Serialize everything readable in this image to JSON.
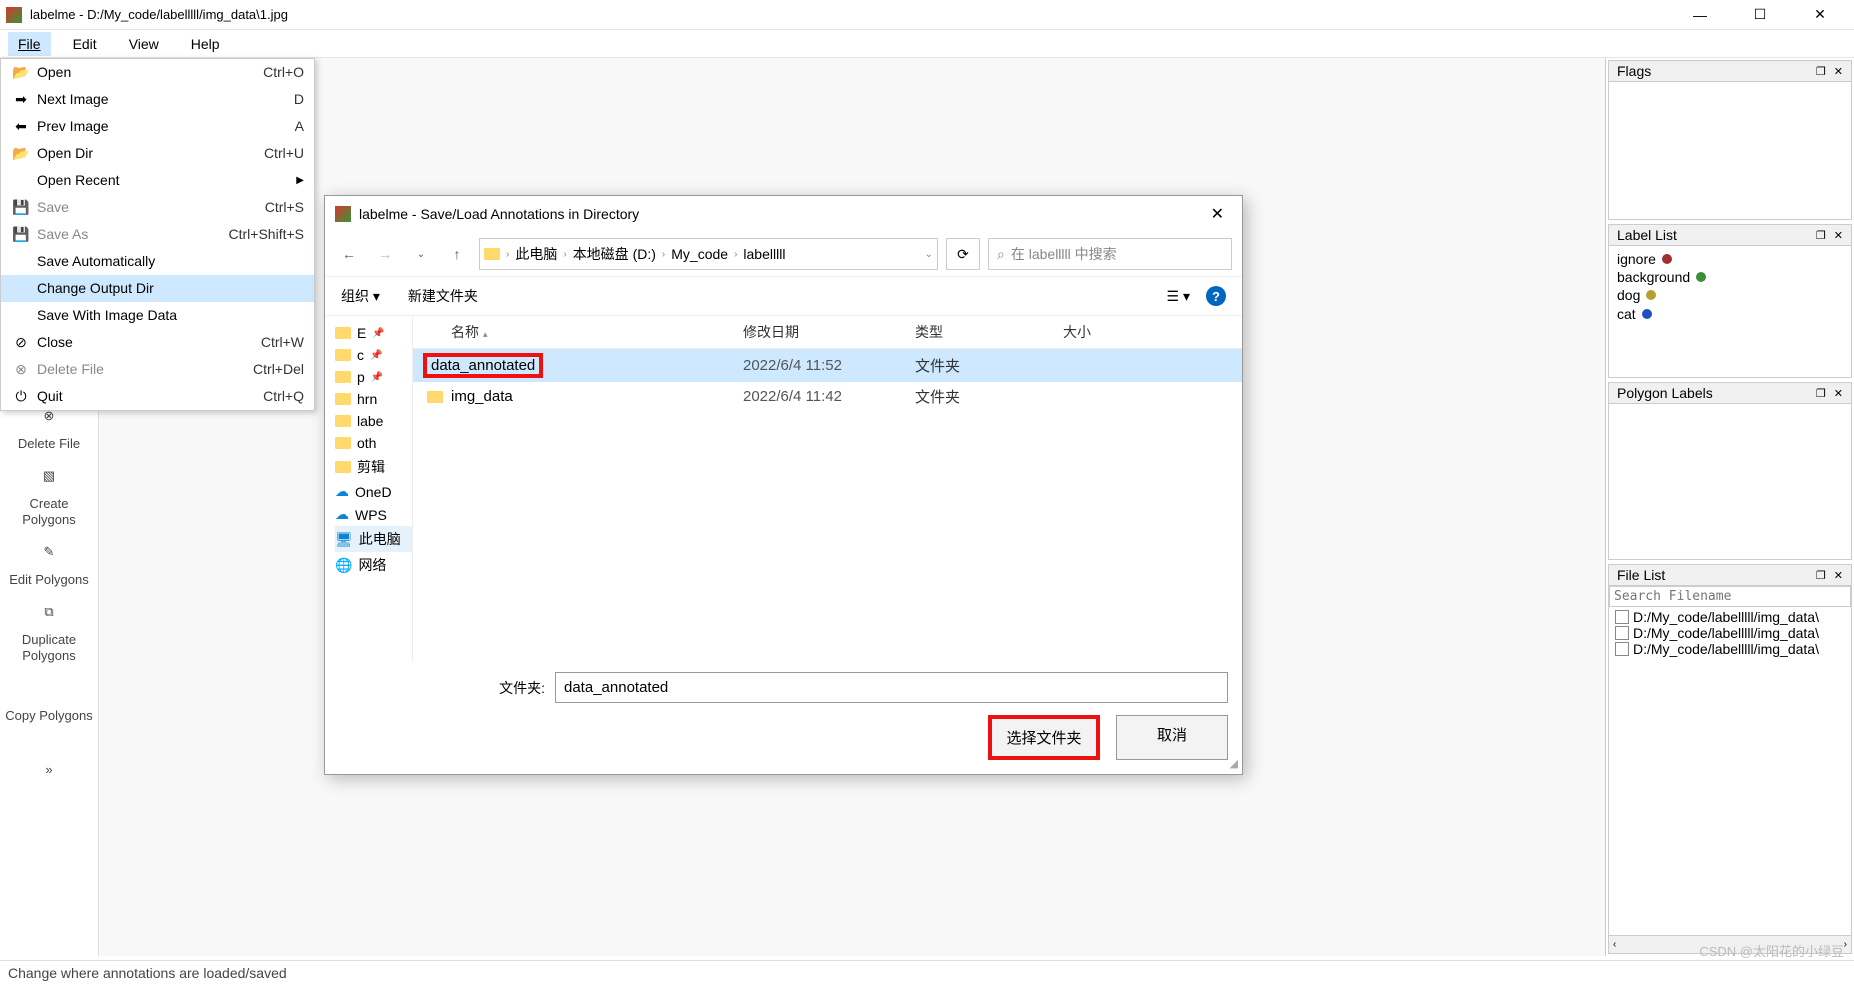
{
  "window": {
    "title": "labelme - D:/My_code/labelllll/img_data\\1.jpg"
  },
  "menubar": {
    "items": [
      "File",
      "Edit",
      "View",
      "Help"
    ],
    "active_index": 0
  },
  "file_menu": {
    "items": [
      {
        "label": "Open",
        "short": "Ctrl+O",
        "icon": "open"
      },
      {
        "label": "Next Image",
        "short": "D",
        "icon": "next"
      },
      {
        "label": "Prev Image",
        "short": "A",
        "icon": "prev"
      },
      {
        "label": "Open Dir",
        "short": "Ctrl+U",
        "icon": "open"
      },
      {
        "label": "Open Recent",
        "short": "",
        "icon": "",
        "arrow": true
      },
      {
        "label": "Save",
        "short": "Ctrl+S",
        "icon": "save",
        "disabled": true
      },
      {
        "label": "Save As",
        "short": "Ctrl+Shift+S",
        "icon": "saveas",
        "disabled": true
      },
      {
        "label": "Save Automatically",
        "short": "",
        "icon": ""
      },
      {
        "label": "Change Output Dir",
        "short": "",
        "icon": "",
        "highlight": true
      },
      {
        "label": "Save With Image Data",
        "short": "",
        "icon": ""
      },
      {
        "label": "Close",
        "short": "Ctrl+W",
        "icon": "close"
      },
      {
        "label": "Delete File",
        "short": "Ctrl+Del",
        "icon": "delete",
        "disabled": true
      },
      {
        "label": "Quit",
        "short": "Ctrl+Q",
        "icon": "quit"
      }
    ]
  },
  "toolbar": {
    "items": [
      {
        "label": "Delete\nFile"
      },
      {
        "label": "Create\nPolygons"
      },
      {
        "label": "Edit\nPolygons"
      },
      {
        "label": "Duplicate\nPolygons"
      },
      {
        "label": "Copy\nPolygons"
      }
    ],
    "chevron": "»"
  },
  "panels": {
    "flags": {
      "title": "Flags"
    },
    "labellist": {
      "title": "Label List",
      "items": [
        {
          "text": "ignore",
          "color": "#a03030"
        },
        {
          "text": "background",
          "color": "#3a8f3a"
        },
        {
          "text": "dog",
          "color": "#b8a030"
        },
        {
          "text": "cat",
          "color": "#2050c0"
        }
      ]
    },
    "polygonlabels": {
      "title": "Polygon Labels"
    },
    "filelist": {
      "title": "File List",
      "search_placeholder": "Search Filename",
      "items": [
        "D:/My_code/labelllll/img_data\\",
        "D:/My_code/labelllll/img_data\\",
        "D:/My_code/labelllll/img_data\\"
      ]
    },
    "btn_float": "❐",
    "btn_close": "✕"
  },
  "dialog": {
    "title": "labelme - Save/Load Annotations in Directory",
    "breadcrumb": [
      "此电脑",
      "本地磁盘 (D:)",
      "My_code",
      "labelllll"
    ],
    "search_placeholder": "在 labelllll 中搜索",
    "organize": "组织",
    "new_folder": "新建文件夹",
    "columns": {
      "name": "名称",
      "date": "修改日期",
      "type": "类型",
      "size": "大小"
    },
    "rows": [
      {
        "name": "data_annotated",
        "date": "2022/6/4 11:52",
        "type": "文件夹",
        "selected": true,
        "redbox": true
      },
      {
        "name": "img_data",
        "date": "2022/6/4 11:42",
        "type": "文件夹"
      }
    ],
    "tree": [
      {
        "label": "E",
        "pin": true
      },
      {
        "label": "c",
        "pin": true
      },
      {
        "label": "p",
        "pin": true
      },
      {
        "label": "hrn"
      },
      {
        "label": "labe"
      },
      {
        "label": "oth"
      },
      {
        "label": "剪辑"
      },
      {
        "label": "OneD",
        "cloud": true
      },
      {
        "label": "WPS",
        "cloud": true
      },
      {
        "label": "此电脑",
        "pc": true,
        "selected": true
      },
      {
        "label": "网络",
        "net": true
      }
    ],
    "folder_label": "文件夹:",
    "folder_value": "data_annotated",
    "btn_select": "选择文件夹",
    "btn_cancel": "取消"
  },
  "statusbar": {
    "text": "Change where annotations are loaded/saved"
  },
  "watermark": "CSDN @太阳花的小绿豆"
}
